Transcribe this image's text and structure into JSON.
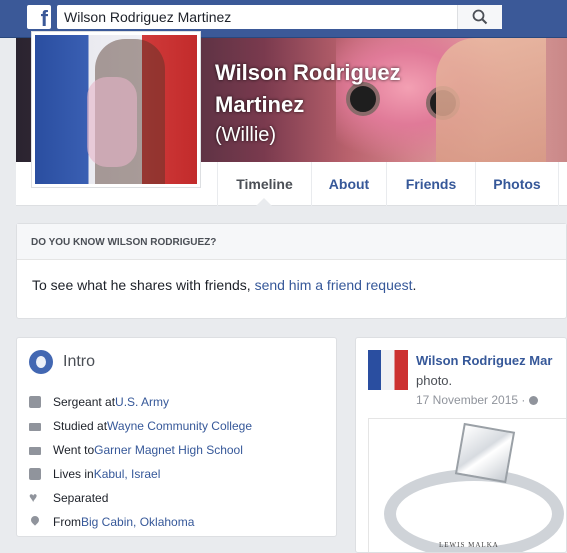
{
  "header": {
    "logo": "f",
    "search_value": "Wilson Rodriguez Martinez",
    "search_icon": "search-icon"
  },
  "profile": {
    "name_line1": "Wilson Rodriguez",
    "name_line2": "Martinez",
    "nickname": "(Willie)"
  },
  "nav": {
    "tabs": [
      {
        "label": "Timeline",
        "active": true
      },
      {
        "label": "About"
      },
      {
        "label": "Friends"
      },
      {
        "label": "Photos"
      }
    ]
  },
  "know": {
    "heading": "DO YOU KNOW WILSON RODRIGUEZ?",
    "text": "To see what he shares with friends, ",
    "link": "send him a friend request",
    "end": "."
  },
  "intro": {
    "title": "Intro",
    "rows": [
      {
        "icon": "briefcase-icon",
        "prefix": "Sergeant at ",
        "link": "U.S. Army"
      },
      {
        "icon": "graduation-cap-icon",
        "prefix": "Studied at ",
        "link": "Wayne Community College"
      },
      {
        "icon": "graduation-cap-icon",
        "prefix": "Went to ",
        "link": "Garner Magnet High School"
      },
      {
        "icon": "home-icon",
        "prefix": "Lives in ",
        "link": "Kabul, Israel"
      },
      {
        "icon": "heart-icon",
        "prefix": "Separated",
        "link": ""
      },
      {
        "icon": "location-pin-icon",
        "prefix": "From ",
        "link": "Big Cabin, Oklahoma"
      }
    ]
  },
  "post": {
    "author": "Wilson Rodriguez Mar",
    "sub": "photo.",
    "date": "17 November 2015 · ",
    "image_caption": "LEWIS MALKA"
  },
  "colors": {
    "brand": "#3b5998",
    "link": "#365899",
    "background": "#e9ebee"
  }
}
